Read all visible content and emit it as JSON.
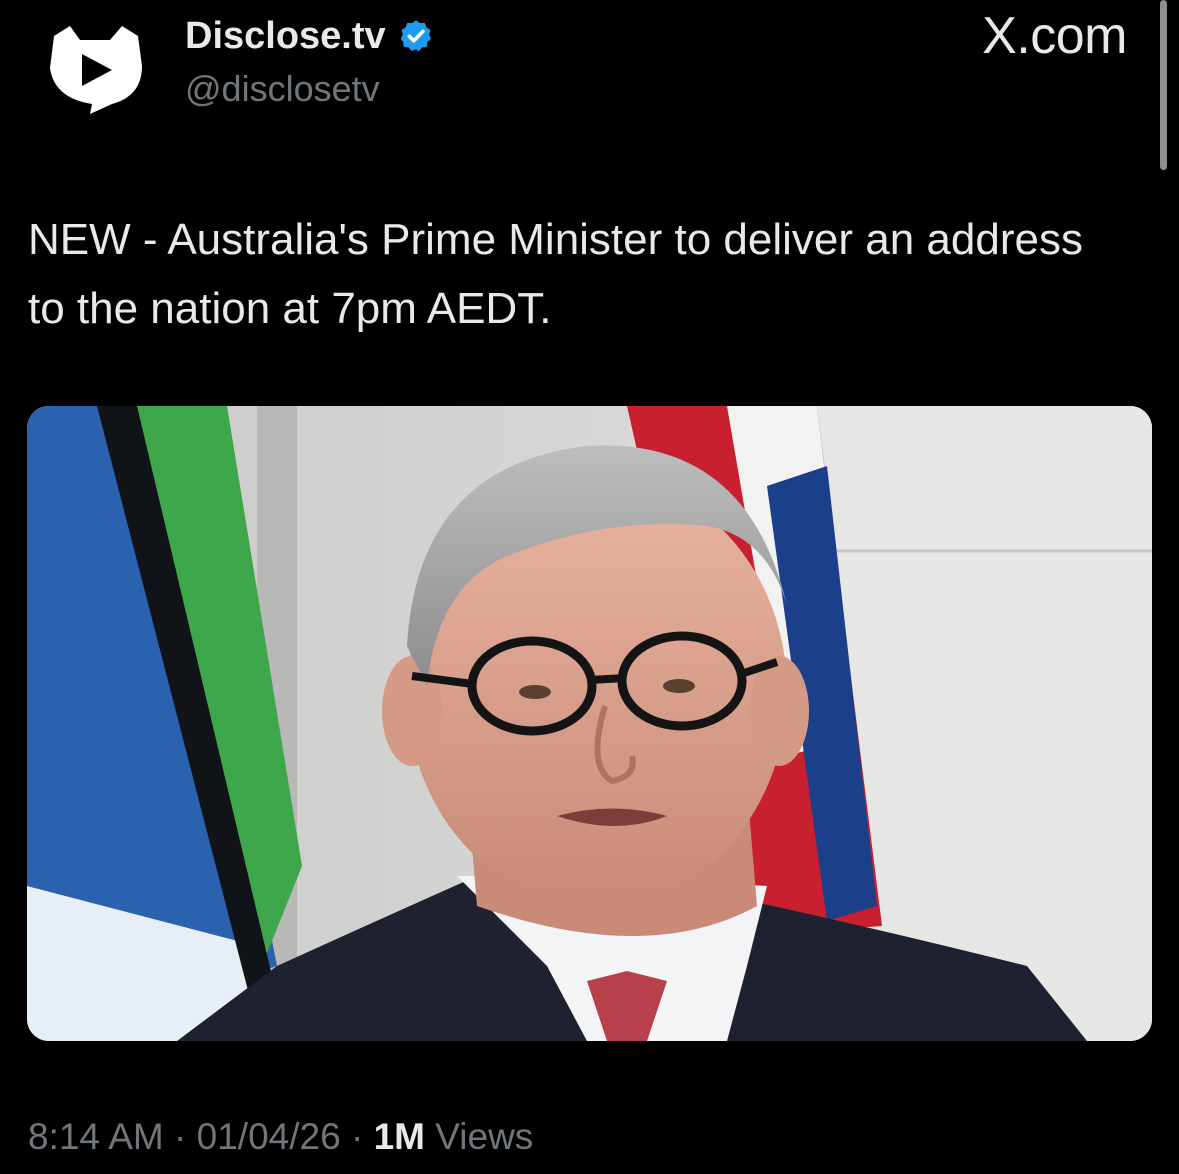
{
  "author": {
    "name": "Disclose.tv",
    "handle": "@disclosetv",
    "verified": true,
    "avatar_icon": "disclose-play-logo-icon"
  },
  "site_mark": "X.com",
  "post": {
    "text": "NEW - Australia's Prime Minister to deliver an address to the nation at 7pm AEDT."
  },
  "media": {
    "description_icon": "press-photo"
  },
  "meta": {
    "time": "8:14 AM",
    "separator_1": " · ",
    "date": "01/04/26",
    "separator_2": " · ",
    "views_count": "1M",
    "views_label": " Views"
  },
  "colors": {
    "background": "#000000",
    "primary_text": "#e7e9ea",
    "secondary_text": "#71767b",
    "verified": "#1d9bf0"
  }
}
